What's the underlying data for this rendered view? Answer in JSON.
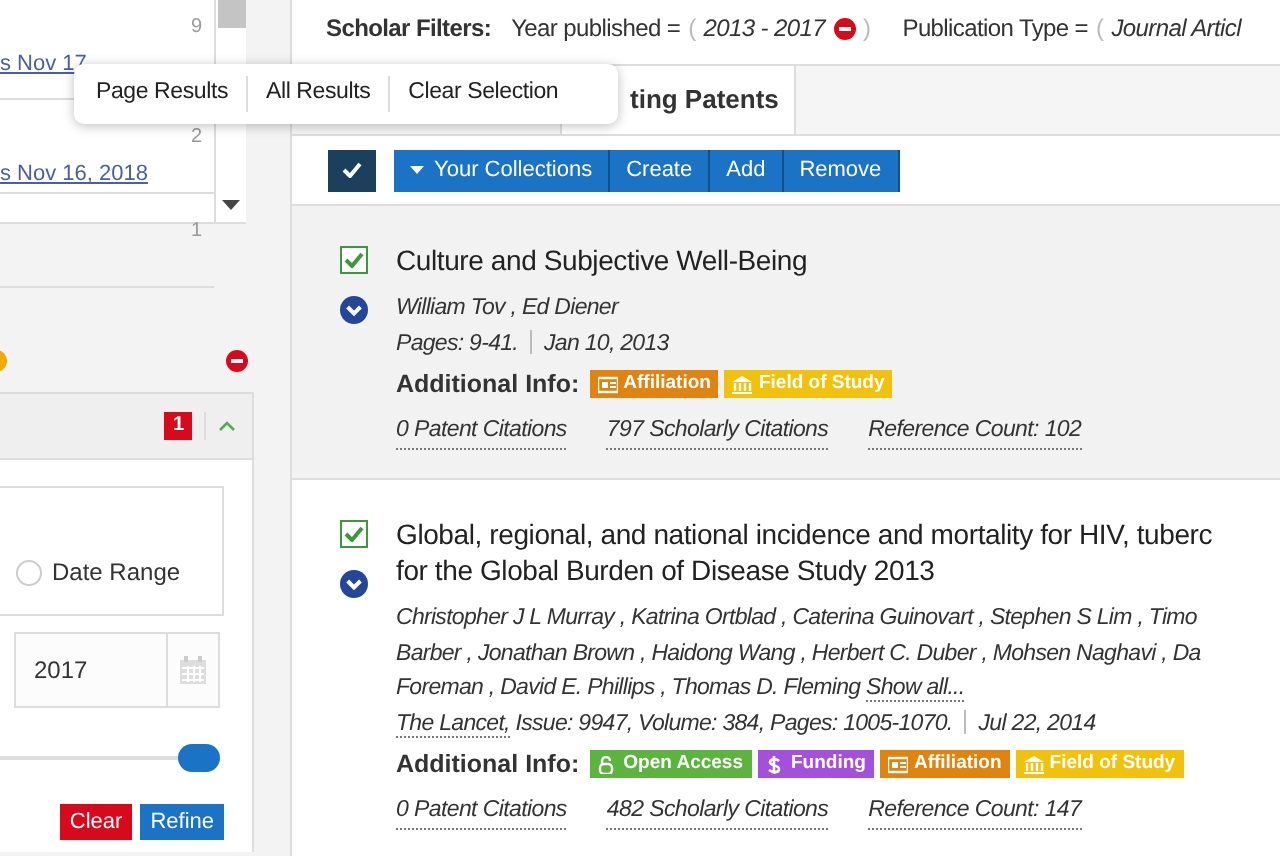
{
  "sidebar": {
    "list_rows": [
      {
        "count": "9",
        "link": "s Nov 17"
      },
      {
        "count": "2",
        "link": "s Nov 16, 2018"
      },
      {
        "count": "1"
      }
    ],
    "filter_panel": {
      "badge": "1",
      "expanded": true,
      "radio": {
        "label": "Date Range",
        "selected": false
      },
      "year_field": {
        "value": "2017"
      },
      "slider": {
        "level": 1.0
      },
      "buttons": [
        {
          "label": "Clear",
          "kind": "danger"
        },
        {
          "label": "Refine",
          "kind": "primary"
        }
      ]
    }
  },
  "filters": {
    "label": "Scholar Filters:",
    "items": [
      {
        "name": "Year published =",
        "open_paren": "(",
        "value": "2013 - 2017",
        "removable": true,
        "close_paren": ")"
      },
      {
        "name": "Publication Type =",
        "open_paren": "(",
        "value": "Journal Articl",
        "removable": false
      }
    ]
  },
  "tabs": [
    {
      "label": "ting Patents",
      "selected": true
    }
  ],
  "popover": {
    "items": [
      "Page Results",
      "All Results",
      "Clear Selection"
    ]
  },
  "toolbar": {
    "select_all_checked": true,
    "collection_buttons": [
      "Your Collections",
      "Create",
      "Add",
      "Remove"
    ]
  },
  "results": [
    {
      "checked": true,
      "expanded": false,
      "highlighted": true,
      "title_lines": [
        "Culture and Subjective Well-Being"
      ],
      "author_lines": [
        "William Tov , Ed Diener"
      ],
      "details": "Pages: 9-41.",
      "date": "Jan 10, 2013",
      "info_label": "Additional Info:",
      "tags": [
        {
          "kind": "affiliation",
          "label": "Affiliation",
          "color": "#e0830f"
        },
        {
          "kind": "field",
          "label": "Field of Study",
          "color": "#f2c10a"
        }
      ],
      "citations": [
        "0 Patent Citations",
        "797 Scholarly Citations",
        "Reference Count: 102"
      ]
    },
    {
      "checked": true,
      "expanded": false,
      "highlighted": false,
      "title_lines": [
        "Global, regional, and national incidence and mortality for HIV, tuberc",
        "for the Global Burden of Disease Study 2013"
      ],
      "author_lines": [
        "Christopher J L Murray , Katrina Ortblad , Caterina Guinovart , Stephen S Lim , Timo",
        "Barber , Jonathan Brown , Haidong Wang , Herbert C. Duber , Mohsen Naghavi , Da",
        "Foreman , David E. Phillips , Thomas D. Fleming"
      ],
      "show_all": "Show all...",
      "source": "The Lancet,",
      "details": "Issue: 9947,  Volume: 384,  Pages: 1005-1070.",
      "date": "Jul 22, 2014",
      "info_label": "Additional Info:",
      "tags": [
        {
          "kind": "open_access",
          "label": "Open Access",
          "color": "#5cb43f"
        },
        {
          "kind": "funding",
          "label": "Funding",
          "color": "#a550dc"
        },
        {
          "kind": "affiliation",
          "label": "Affiliation",
          "color": "#e0830f"
        },
        {
          "kind": "field",
          "label": "Field of Study",
          "color": "#f2c10a"
        }
      ],
      "citations": [
        "0 Patent Citations",
        "482 Scholarly Citations",
        "Reference Count: 147"
      ]
    }
  ]
}
